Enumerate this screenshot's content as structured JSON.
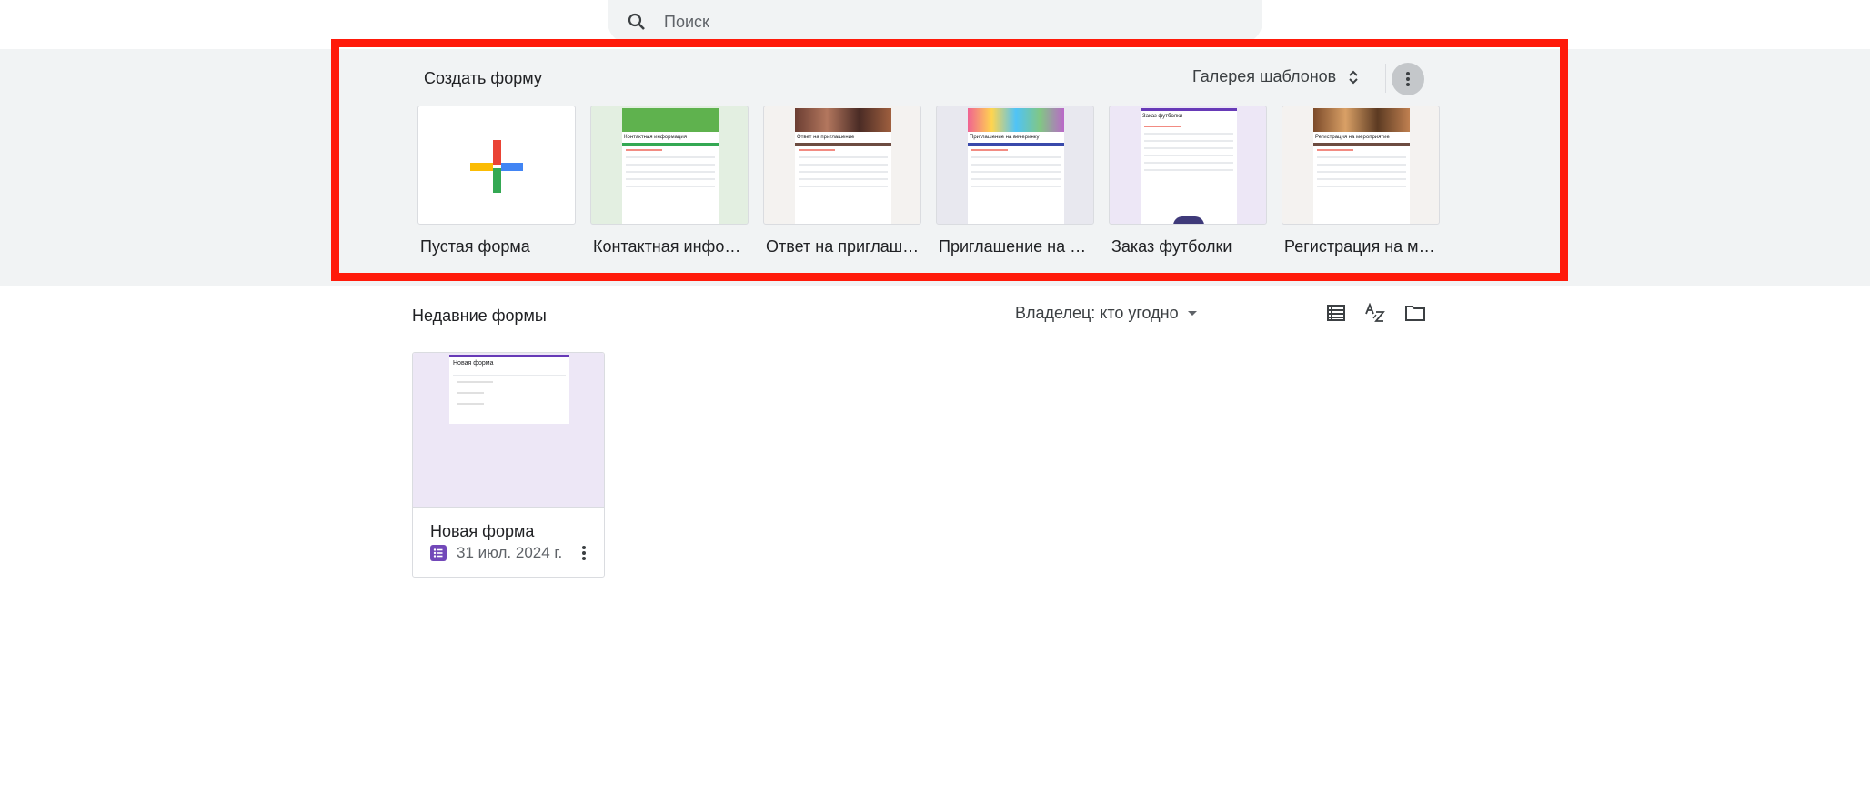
{
  "search": {
    "placeholder": "Поиск"
  },
  "templates_section": {
    "title": "Создать форму",
    "gallery_label": "Галерея шаблонов",
    "templates": [
      {
        "label": "Пустая форма"
      },
      {
        "label": "Контактная информация",
        "preview_title": "Контактная информация"
      },
      {
        "label": "Ответ на приглашение",
        "preview_title": "Ответ на приглашение"
      },
      {
        "label": "Приглашение на вечеринку",
        "preview_title": "Приглашение на вечеринку"
      },
      {
        "label": "Заказ футболки",
        "preview_title": "Заказ футболки"
      },
      {
        "label": "Регистрация на мероприятие",
        "preview_title": "Регистрация на мероприятие"
      }
    ]
  },
  "recent_section": {
    "title": "Недавние формы",
    "owner_filter": "Владелец: кто угодно"
  },
  "documents": [
    {
      "name": "Новая форма",
      "date": "31 июл. 2024 г.",
      "preview_title": "Новая форма"
    }
  ],
  "colors": {
    "band_bg": "#f1f3f4",
    "highlight": "#ff1a0a",
    "forms_purple": "#7248b9"
  }
}
